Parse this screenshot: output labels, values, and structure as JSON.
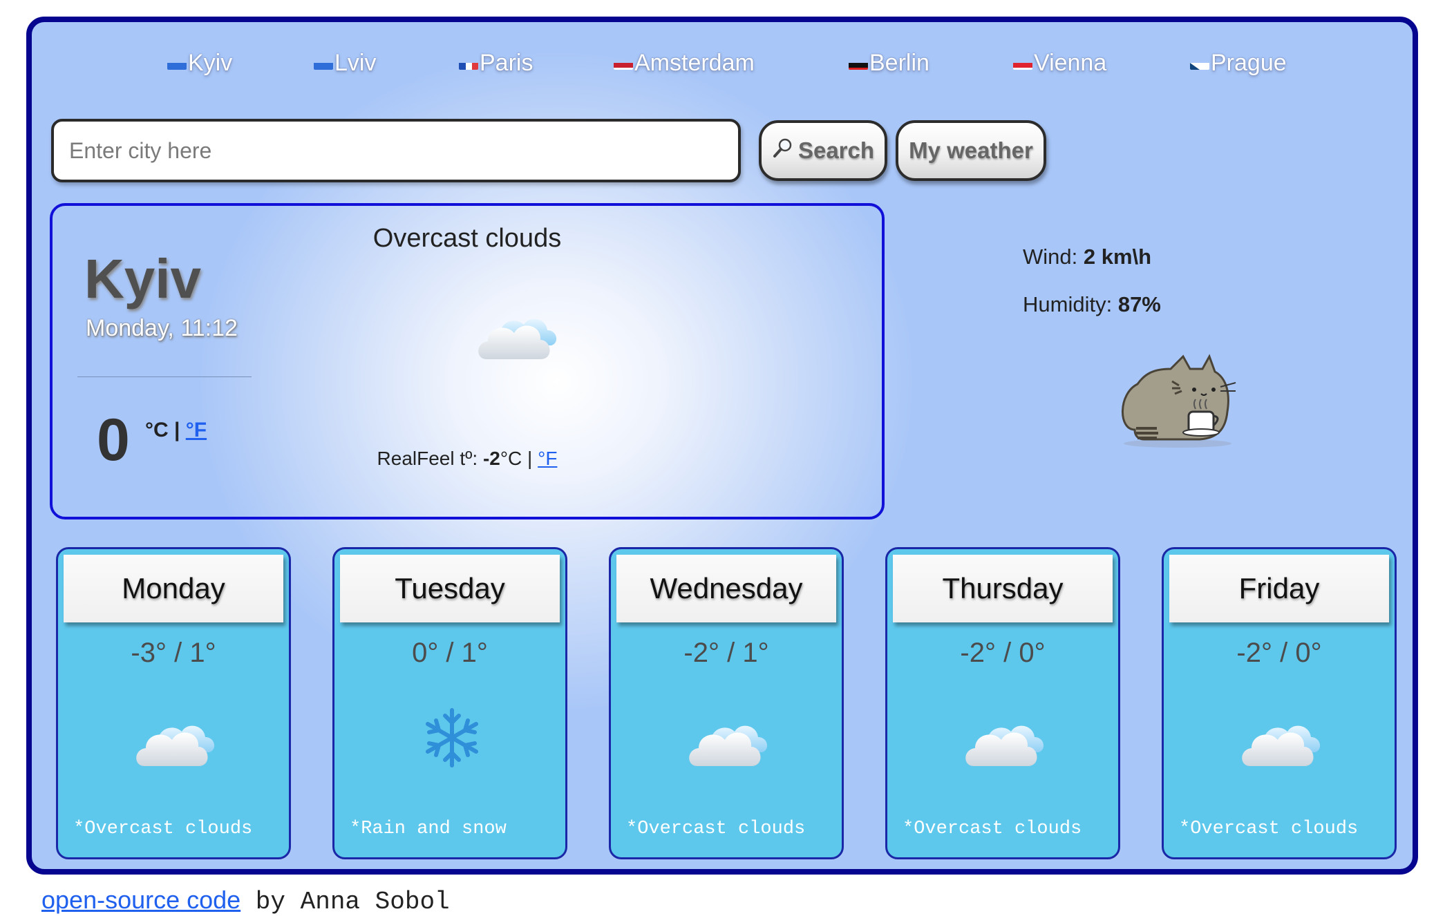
{
  "cities": [
    {
      "label": "Kyiv",
      "flag": "ukraine-flag-icon"
    },
    {
      "label": "Lviv",
      "flag": "ukraine-flag-icon"
    },
    {
      "label": "Paris",
      "flag": "france-flag-icon"
    },
    {
      "label": "Amsterdam",
      "flag": "netherlands-flag-icon"
    },
    {
      "label": "Berlin",
      "flag": "germany-flag-icon"
    },
    {
      "label": "Vienna",
      "flag": "austria-flag-icon"
    },
    {
      "label": "Prague",
      "flag": "czech-flag-icon"
    }
  ],
  "search": {
    "placeholder": "Enter city here",
    "value": "",
    "search_label": "Search",
    "search_icon": "magnifier-icon",
    "my_weather_label": "My weather"
  },
  "current": {
    "city": "Kyiv",
    "datetime": "Monday, 11:12",
    "temperature": "0",
    "unit_c": "°C",
    "unit_sep": "|",
    "unit_f": "°F",
    "description": "Overcast clouds",
    "icon": "cloud-icon",
    "realfeel_label": "RealFeel tº:",
    "realfeel_value": "-2",
    "realfeel_unit_c": "°C |",
    "realfeel_unit_f": "°F"
  },
  "details": {
    "wind_label": "Wind:",
    "wind_value": "2 km\\h",
    "humidity_label": "Humidity:",
    "humidity_value": "87%",
    "mascot": "pusheen-cat-coffee-icon"
  },
  "forecast": [
    {
      "day": "Monday",
      "temps": "-3° / 1°",
      "icon": "cloud-icon",
      "desc": "*Overcast clouds"
    },
    {
      "day": "Tuesday",
      "temps": "0° / 1°",
      "icon": "snowflake-icon",
      "desc": "*Rain and snow"
    },
    {
      "day": "Wednesday",
      "temps": "-2° / 1°",
      "icon": "cloud-icon",
      "desc": "*Overcast clouds"
    },
    {
      "day": "Thursday",
      "temps": "-2° / 0°",
      "icon": "cloud-icon",
      "desc": "*Overcast clouds"
    },
    {
      "day": "Friday",
      "temps": "-2° / 0°",
      "icon": "cloud-icon",
      "desc": "*Overcast clouds"
    }
  ],
  "footer": {
    "link_text": "open-source code",
    "by_text": " by Anna Sobol"
  },
  "colors": {
    "frame_border": "#05058f",
    "current_border": "#1010d8",
    "forecast_card": "#5dc7ec",
    "link": "#2060ee"
  }
}
